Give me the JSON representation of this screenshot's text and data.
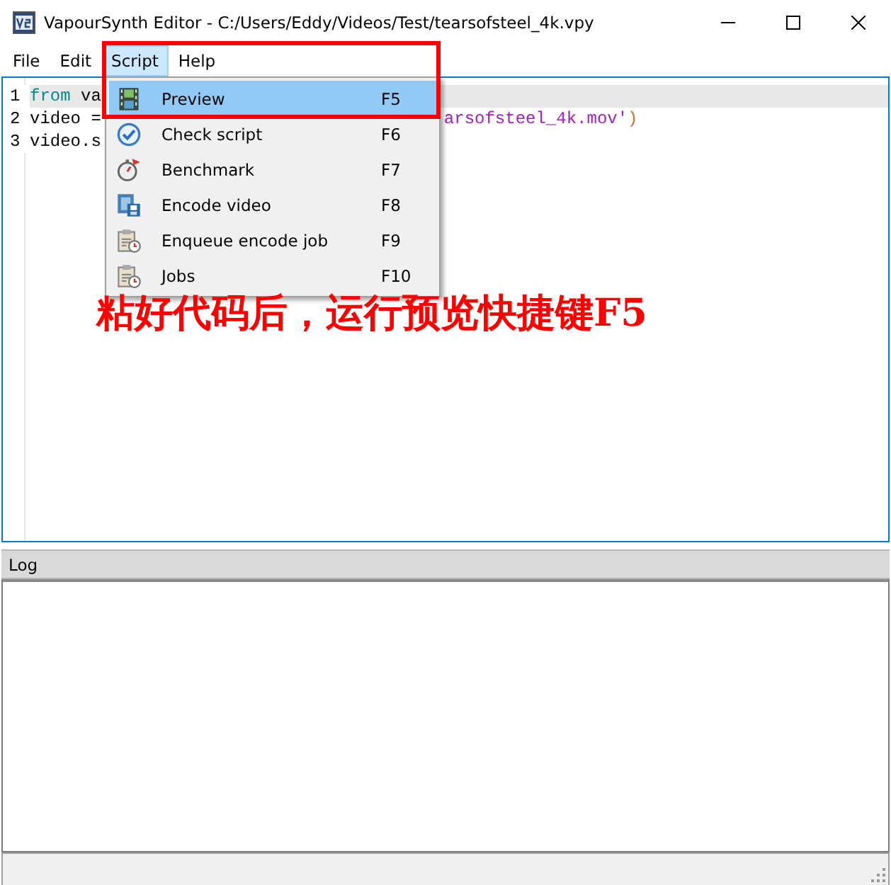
{
  "window": {
    "title": "VapourSynth Editor - C:/Users/Eddy/Videos/Test/tearsofsteel_4k.vpy"
  },
  "menu_bar": [
    {
      "label": "File",
      "selected": false
    },
    {
      "label": "Edit",
      "selected": false
    },
    {
      "label": "Script",
      "selected": true
    },
    {
      "label": "Help",
      "selected": false
    }
  ],
  "editor": {
    "lines": [
      {
        "number": "1",
        "current": true,
        "segments": [
          {
            "kind": "keyword",
            "text": "from"
          },
          {
            "kind": "plain",
            "text": " va"
          }
        ]
      },
      {
        "number": "2",
        "current": false,
        "segments": [
          {
            "kind": "plain",
            "text": "video ="
          },
          {
            "kind": "string",
            "text": "arsofsteel_4k.mov'",
            "gap": true
          },
          {
            "kind": "punct",
            "text": ")"
          }
        ]
      },
      {
        "number": "3",
        "current": false,
        "segments": [
          {
            "kind": "plain",
            "text": "video.s"
          }
        ]
      }
    ]
  },
  "script_menu": {
    "items": [
      {
        "kind": "film",
        "label": "Preview",
        "shortcut": "F5",
        "selected": true
      },
      {
        "kind": "check",
        "label": "Check script",
        "shortcut": "F6",
        "selected": false
      },
      {
        "kind": "stopwatch",
        "label": "Benchmark",
        "shortcut": "F7",
        "selected": false
      },
      {
        "kind": "encode",
        "label": "Encode video",
        "shortcut": "F8",
        "selected": false
      },
      {
        "kind": "jobs",
        "label": "Enqueue encode job",
        "shortcut": "F9",
        "selected": false
      },
      {
        "kind": "jobs",
        "label": "Jobs",
        "shortcut": "F10",
        "selected": false
      }
    ]
  },
  "annotation": {
    "text": "粘好代码后，运行预览快捷键F5"
  },
  "log_panel": {
    "title": "Log"
  }
}
